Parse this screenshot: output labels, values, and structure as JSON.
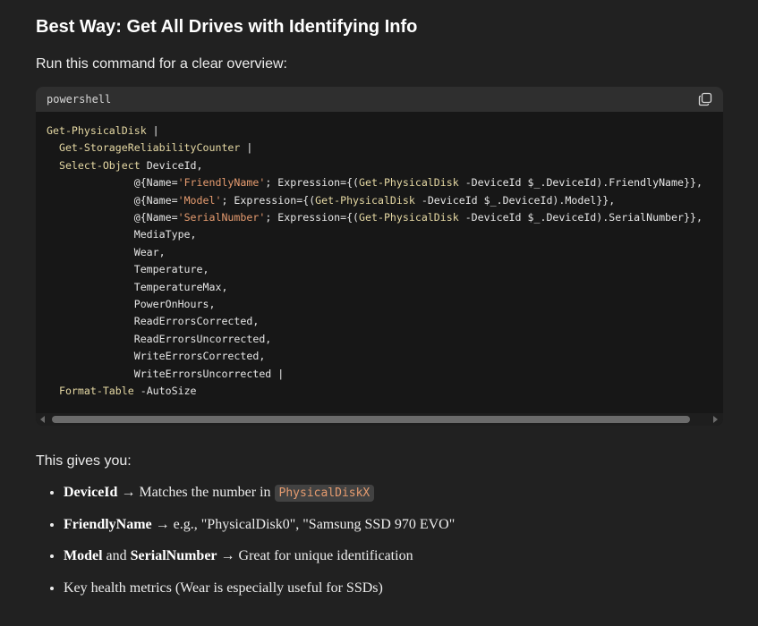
{
  "heading": "Best Way: Get All Drives with Identifying Info",
  "intro": "Run this command for a clear overview:",
  "code_block": {
    "language": "powershell",
    "copy_icon": "copy-icon",
    "lines": [
      "Get-PhysicalDisk |",
      "  Get-StorageReliabilityCounter |",
      "  Select-Object DeviceId,",
      "              @{Name='FriendlyName'; Expression={(Get-PhysicalDisk -DeviceId $_.DeviceId).FriendlyName}},",
      "              @{Name='Model'; Expression={(Get-PhysicalDisk -DeviceId $_.DeviceId).Model}},",
      "              @{Name='SerialNumber'; Expression={(Get-PhysicalDisk -DeviceId $_.DeviceId).SerialNumber}},",
      "              MediaType,",
      "              Wear,",
      "              Temperature,",
      "              TemperatureMax,",
      "              PowerOnHours,",
      "              ReadErrorsCorrected,",
      "              ReadErrorsUncorrected,",
      "              WriteErrorsCorrected,",
      "              WriteErrorsUncorrected |",
      "  Format-Table -AutoSize"
    ]
  },
  "gives_label": "This gives you:",
  "bullets": [
    {
      "bold": "DeviceId",
      "rest": " → Matches the number in ",
      "code": "PhysicalDiskX"
    },
    {
      "bold": "FriendlyName",
      "rest": " → e.g., \"PhysicalDisk0\", \"Samsung SSD 970 EVO\""
    },
    {
      "bold": "Model",
      "mid": " and ",
      "bold2": "SerialNumber",
      "rest": " → Great for unique identification"
    },
    {
      "rest": "Key health metrics (Wear is especially useful for SSDs)"
    }
  ],
  "colors": {
    "background": "#212121",
    "code_bg": "#171717",
    "code_header_bg": "#2f2f2f",
    "cmdlet": "#e5d8a3",
    "string": "#e59b6f"
  }
}
